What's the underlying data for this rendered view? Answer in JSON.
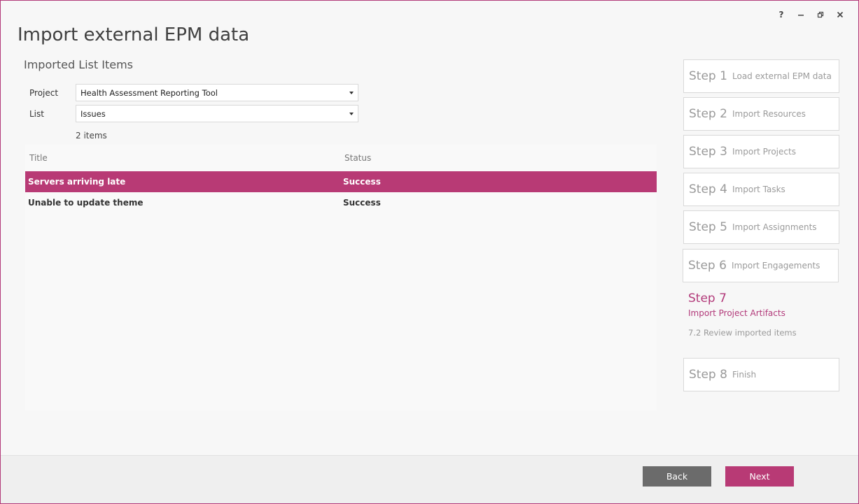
{
  "window": {
    "controls": [
      "?",
      "–",
      "❐",
      "✕"
    ]
  },
  "app_title": "Import external EPM data",
  "section_title": "Imported List Items",
  "form": {
    "project_label": "Project",
    "project_value": "Health Assessment Reporting Tool",
    "list_label": "List",
    "list_value": "Issues"
  },
  "item_count": "2 items",
  "table": {
    "headers": {
      "title": "Title",
      "status": "Status"
    },
    "rows": [
      {
        "title": "Servers arriving late",
        "status": "Success",
        "selected": true
      },
      {
        "title": "Unable to update theme",
        "status": "Success",
        "selected": false
      }
    ]
  },
  "steps": [
    {
      "num": "Step 1",
      "name": "Load external EPM data"
    },
    {
      "num": "Step 2",
      "name": "Import Resources"
    },
    {
      "num": "Step 3",
      "name": "Import Projects"
    },
    {
      "num": "Step 4",
      "name": "Import Tasks"
    },
    {
      "num": "Step 5",
      "name": "Import Assignments"
    },
    {
      "num": "Step 6",
      "name": "Import Engagements"
    },
    {
      "num": "Step 7",
      "name": "Import Project Artifacts",
      "sub": "7.2 Review imported items"
    },
    {
      "num": "Step 8",
      "name": "Finish"
    }
  ],
  "footer": {
    "back_label": "Back",
    "next_label": "Next"
  },
  "colors": {
    "accent": "#b83a75",
    "back_button": "#6b6b6b",
    "border": "#b23a7a"
  }
}
